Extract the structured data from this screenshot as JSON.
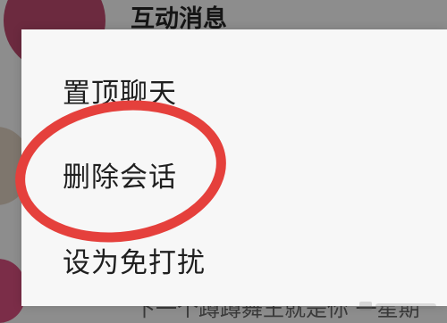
{
  "background": {
    "section_title": "互动消息",
    "preview_text": "下一个蹲蹲舞王就是你 一星期"
  },
  "menu": {
    "items": [
      {
        "label": "置顶聊天"
      },
      {
        "label": "删除会话"
      },
      {
        "label": "设为免打扰"
      }
    ]
  },
  "annotation": {
    "highlight_color": "#e5403c",
    "target": "删除会话"
  }
}
